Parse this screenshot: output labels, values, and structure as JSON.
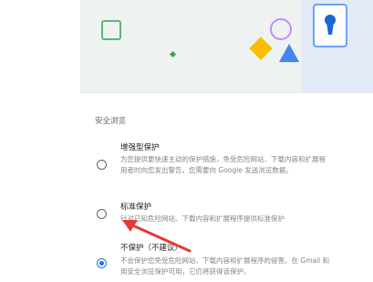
{
  "section_title": "安全浏览",
  "options": [
    {
      "title": "增强型保护",
      "desc_line1": "为您提供更快速主动的保护措施，免受危险网站、下载内容和扩展程",
      "desc_line2": "用者时向您发出警告。您需要向 Google 发送浏览数据。",
      "checked": false
    },
    {
      "title": "标准保护",
      "desc_line1": "针对已知危险网站、下载内容和扩展程序提供标准保护",
      "checked": false
    },
    {
      "title": "不保护（不建议）",
      "desc_line1": "不会保护您免受危险网站、下载内容和扩展程序的侵害。在 Gmail 和",
      "desc_line2": "用安全浏览保护可用，它仍将获得该保护。",
      "checked": true
    }
  ],
  "colors": {
    "accent": "#1a73e8",
    "annotation_arrow": "#e53935",
    "banner_bg": "#eef2f1",
    "banner_right_bg": "#e3eaf7"
  },
  "icons": {
    "lock_keyhole": "keyhole-icon",
    "green_square": "square-outline-icon",
    "yellow_diamond": "diamond-icon",
    "blue_triangle": "triangle-icon",
    "purple_circle": "circle-outline-icon"
  }
}
